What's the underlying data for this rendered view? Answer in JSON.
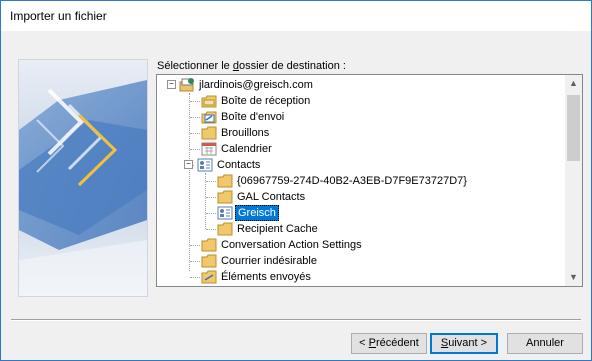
{
  "window": {
    "title": "Importer un fichier"
  },
  "prompt": {
    "before": "Sélectionner le ",
    "access_letter": "d",
    "after": "ossier de destination :"
  },
  "tree": {
    "account": "jlardinois@greisch.com",
    "items": [
      {
        "label": "Boîte de réception",
        "icon": "inbox-icon"
      },
      {
        "label": "Boîte d'envoi",
        "icon": "outbox-icon"
      },
      {
        "label": "Brouillons",
        "icon": "folder-icon"
      },
      {
        "label": "Calendrier",
        "icon": "calendar-icon"
      },
      {
        "label": "Contacts",
        "icon": "contacts-icon"
      },
      {
        "label": "{06967759-274D-40B2-A3EB-D7F9E73727D7}",
        "icon": "folder-icon"
      },
      {
        "label": "GAL Contacts",
        "icon": "folder-icon"
      },
      {
        "label": "Greisch",
        "icon": "contacts-icon",
        "selected": true
      },
      {
        "label": "Recipient Cache",
        "icon": "folder-icon"
      },
      {
        "label": "Conversation Action Settings",
        "icon": "folder-icon"
      },
      {
        "label": "Courrier indésirable",
        "icon": "folder-icon"
      },
      {
        "label": "Éléments envoyés",
        "icon": "sent-icon"
      }
    ],
    "expander_collapse": "−"
  },
  "scrollbar": {
    "up": "▲",
    "down": "▼"
  },
  "buttons": {
    "previous": {
      "before": "< ",
      "key": "P",
      "after": "récédent"
    },
    "next": {
      "key": "S",
      "after": "uivant >"
    },
    "cancel": "Annuler"
  },
  "colors": {
    "accent": "#0078d7",
    "border": "#2b79c7"
  }
}
